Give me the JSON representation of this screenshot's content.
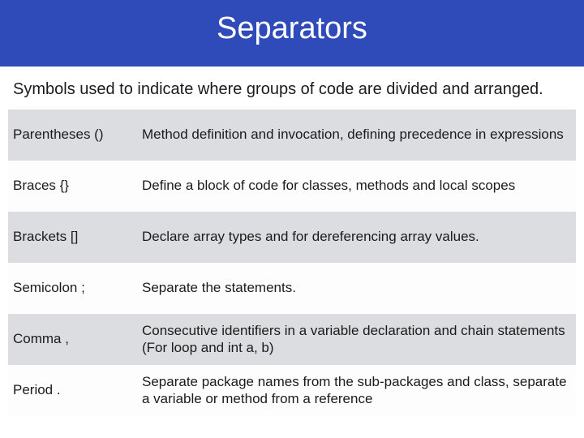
{
  "title": "Separators",
  "intro": "Symbols used to indicate where groups of code are divided and arranged.",
  "rows": [
    {
      "name": "Parentheses ()",
      "desc": "Method definition and invocation, defining precedence in expressions"
    },
    {
      "name": "Braces {}",
      "desc": "Define a block of code for classes, methods and local scopes"
    },
    {
      "name": "Brackets []",
      "desc": "Declare array types and for dereferencing array values."
    },
    {
      "name": "Semicolon ;",
      "desc": "Separate the statements."
    },
    {
      "name": "Comma ,",
      "desc": "Consecutive identifiers in a variable declaration and chain statements (For loop and int a, b)"
    },
    {
      "name": "Period .",
      "desc": "Separate package names from the sub-packages and class, separate  a variable or method from a reference"
    }
  ]
}
